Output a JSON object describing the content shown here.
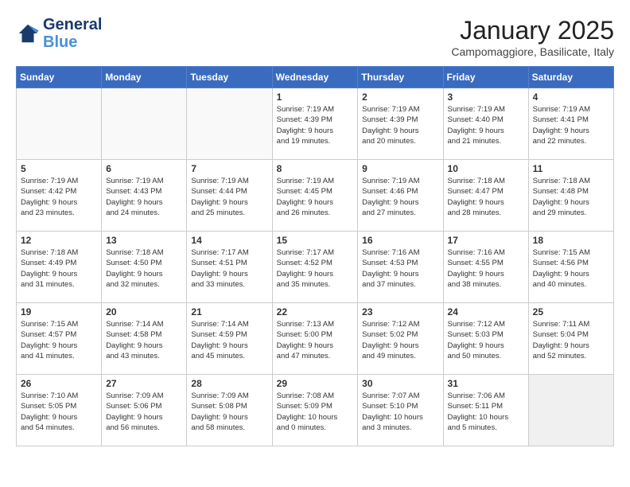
{
  "header": {
    "logo_line1": "General",
    "logo_line2": "Blue",
    "month_title": "January 2025",
    "location": "Campomaggiore, Basilicate, Italy"
  },
  "weekdays": [
    "Sunday",
    "Monday",
    "Tuesday",
    "Wednesday",
    "Thursday",
    "Friday",
    "Saturday"
  ],
  "weeks": [
    [
      {
        "day": "",
        "info": "",
        "empty": true
      },
      {
        "day": "",
        "info": "",
        "empty": true
      },
      {
        "day": "",
        "info": "",
        "empty": true
      },
      {
        "day": "1",
        "info": "Sunrise: 7:19 AM\nSunset: 4:39 PM\nDaylight: 9 hours\nand 19 minutes.",
        "empty": false
      },
      {
        "day": "2",
        "info": "Sunrise: 7:19 AM\nSunset: 4:39 PM\nDaylight: 9 hours\nand 20 minutes.",
        "empty": false
      },
      {
        "day": "3",
        "info": "Sunrise: 7:19 AM\nSunset: 4:40 PM\nDaylight: 9 hours\nand 21 minutes.",
        "empty": false
      },
      {
        "day": "4",
        "info": "Sunrise: 7:19 AM\nSunset: 4:41 PM\nDaylight: 9 hours\nand 22 minutes.",
        "empty": false
      }
    ],
    [
      {
        "day": "5",
        "info": "Sunrise: 7:19 AM\nSunset: 4:42 PM\nDaylight: 9 hours\nand 23 minutes.",
        "empty": false
      },
      {
        "day": "6",
        "info": "Sunrise: 7:19 AM\nSunset: 4:43 PM\nDaylight: 9 hours\nand 24 minutes.",
        "empty": false
      },
      {
        "day": "7",
        "info": "Sunrise: 7:19 AM\nSunset: 4:44 PM\nDaylight: 9 hours\nand 25 minutes.",
        "empty": false
      },
      {
        "day": "8",
        "info": "Sunrise: 7:19 AM\nSunset: 4:45 PM\nDaylight: 9 hours\nand 26 minutes.",
        "empty": false
      },
      {
        "day": "9",
        "info": "Sunrise: 7:19 AM\nSunset: 4:46 PM\nDaylight: 9 hours\nand 27 minutes.",
        "empty": false
      },
      {
        "day": "10",
        "info": "Sunrise: 7:18 AM\nSunset: 4:47 PM\nDaylight: 9 hours\nand 28 minutes.",
        "empty": false
      },
      {
        "day": "11",
        "info": "Sunrise: 7:18 AM\nSunset: 4:48 PM\nDaylight: 9 hours\nand 29 minutes.",
        "empty": false
      }
    ],
    [
      {
        "day": "12",
        "info": "Sunrise: 7:18 AM\nSunset: 4:49 PM\nDaylight: 9 hours\nand 31 minutes.",
        "empty": false
      },
      {
        "day": "13",
        "info": "Sunrise: 7:18 AM\nSunset: 4:50 PM\nDaylight: 9 hours\nand 32 minutes.",
        "empty": false
      },
      {
        "day": "14",
        "info": "Sunrise: 7:17 AM\nSunset: 4:51 PM\nDaylight: 9 hours\nand 33 minutes.",
        "empty": false
      },
      {
        "day": "15",
        "info": "Sunrise: 7:17 AM\nSunset: 4:52 PM\nDaylight: 9 hours\nand 35 minutes.",
        "empty": false
      },
      {
        "day": "16",
        "info": "Sunrise: 7:16 AM\nSunset: 4:53 PM\nDaylight: 9 hours\nand 37 minutes.",
        "empty": false
      },
      {
        "day": "17",
        "info": "Sunrise: 7:16 AM\nSunset: 4:55 PM\nDaylight: 9 hours\nand 38 minutes.",
        "empty": false
      },
      {
        "day": "18",
        "info": "Sunrise: 7:15 AM\nSunset: 4:56 PM\nDaylight: 9 hours\nand 40 minutes.",
        "empty": false
      }
    ],
    [
      {
        "day": "19",
        "info": "Sunrise: 7:15 AM\nSunset: 4:57 PM\nDaylight: 9 hours\nand 41 minutes.",
        "empty": false
      },
      {
        "day": "20",
        "info": "Sunrise: 7:14 AM\nSunset: 4:58 PM\nDaylight: 9 hours\nand 43 minutes.",
        "empty": false
      },
      {
        "day": "21",
        "info": "Sunrise: 7:14 AM\nSunset: 4:59 PM\nDaylight: 9 hours\nand 45 minutes.",
        "empty": false
      },
      {
        "day": "22",
        "info": "Sunrise: 7:13 AM\nSunset: 5:00 PM\nDaylight: 9 hours\nand 47 minutes.",
        "empty": false
      },
      {
        "day": "23",
        "info": "Sunrise: 7:12 AM\nSunset: 5:02 PM\nDaylight: 9 hours\nand 49 minutes.",
        "empty": false
      },
      {
        "day": "24",
        "info": "Sunrise: 7:12 AM\nSunset: 5:03 PM\nDaylight: 9 hours\nand 50 minutes.",
        "empty": false
      },
      {
        "day": "25",
        "info": "Sunrise: 7:11 AM\nSunset: 5:04 PM\nDaylight: 9 hours\nand 52 minutes.",
        "empty": false
      }
    ],
    [
      {
        "day": "26",
        "info": "Sunrise: 7:10 AM\nSunset: 5:05 PM\nDaylight: 9 hours\nand 54 minutes.",
        "empty": false
      },
      {
        "day": "27",
        "info": "Sunrise: 7:09 AM\nSunset: 5:06 PM\nDaylight: 9 hours\nand 56 minutes.",
        "empty": false
      },
      {
        "day": "28",
        "info": "Sunrise: 7:09 AM\nSunset: 5:08 PM\nDaylight: 9 hours\nand 58 minutes.",
        "empty": false
      },
      {
        "day": "29",
        "info": "Sunrise: 7:08 AM\nSunset: 5:09 PM\nDaylight: 10 hours\nand 0 minutes.",
        "empty": false
      },
      {
        "day": "30",
        "info": "Sunrise: 7:07 AM\nSunset: 5:10 PM\nDaylight: 10 hours\nand 3 minutes.",
        "empty": false
      },
      {
        "day": "31",
        "info": "Sunrise: 7:06 AM\nSunset: 5:11 PM\nDaylight: 10 hours\nand 5 minutes.",
        "empty": false
      },
      {
        "day": "",
        "info": "",
        "empty": true
      }
    ]
  ]
}
